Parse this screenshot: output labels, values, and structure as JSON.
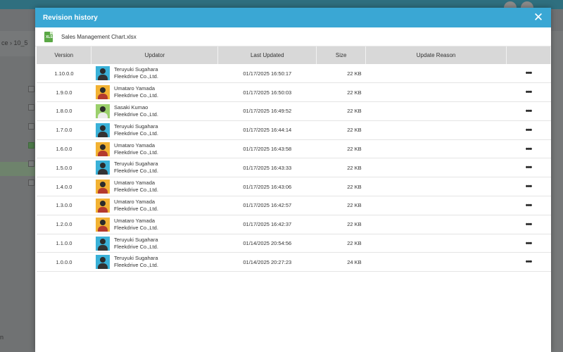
{
  "modal": {
    "title": "Revision history",
    "close_icon": "close-icon",
    "file": {
      "icon": "xlsx-file-icon",
      "icon_text": "XLS",
      "name": "Sales Management Chart.xlsx"
    }
  },
  "background": {
    "breadcrumb": "ce  ›  10_5",
    "footer_text": "n"
  },
  "columns": [
    "Version",
    "Updator",
    "Last Updated",
    "Size",
    "Update Reason",
    ""
  ],
  "rows": [
    {
      "version": "1.10.0.0",
      "name": "Teruyuki Sugahara",
      "company": "Fleekdrive Co.,Ltd.",
      "avatar": "blue",
      "updated": "01/17/2025 16:50:17",
      "size": "22 KB",
      "reason": ""
    },
    {
      "version": "1.9.0.0",
      "name": "Umataro Yamada",
      "company": "Fleekdrive Co.,Ltd.",
      "avatar": "yellow",
      "updated": "01/17/2025 16:50:03",
      "size": "22 KB",
      "reason": ""
    },
    {
      "version": "1.8.0.0",
      "name": "Sasaki Kumao",
      "company": "Fleekdrive Co.,Ltd.",
      "avatar": "green",
      "updated": "01/17/2025 16:49:52",
      "size": "22 KB",
      "reason": ""
    },
    {
      "version": "1.7.0.0",
      "name": "Teruyuki Sugahara",
      "company": "Fleekdrive Co.,Ltd.",
      "avatar": "blue",
      "updated": "01/17/2025 16:44:14",
      "size": "22 KB",
      "reason": ""
    },
    {
      "version": "1.6.0.0",
      "name": "Umataro Yamada",
      "company": "Fleekdrive Co.,Ltd.",
      "avatar": "yellow",
      "updated": "01/17/2025 16:43:58",
      "size": "22 KB",
      "reason": ""
    },
    {
      "version": "1.5.0.0",
      "name": "Teruyuki Sugahara",
      "company": "Fleekdrive Co.,Ltd.",
      "avatar": "blue",
      "updated": "01/17/2025 16:43:33",
      "size": "22 KB",
      "reason": ""
    },
    {
      "version": "1.4.0.0",
      "name": "Umataro Yamada",
      "company": "Fleekdrive Co.,Ltd.",
      "avatar": "yellow",
      "updated": "01/17/2025 16:43:06",
      "size": "22 KB",
      "reason": ""
    },
    {
      "version": "1.3.0.0",
      "name": "Umataro Yamada",
      "company": "Fleekdrive Co.,Ltd.",
      "avatar": "yellow",
      "updated": "01/17/2025 16:42:57",
      "size": "22 KB",
      "reason": ""
    },
    {
      "version": "1.2.0.0",
      "name": "Umataro Yamada",
      "company": "Fleekdrive Co.,Ltd.",
      "avatar": "yellow",
      "updated": "01/17/2025 16:42:37",
      "size": "22 KB",
      "reason": ""
    },
    {
      "version": "1.1.0.0",
      "name": "Teruyuki Sugahara",
      "company": "Fleekdrive Co.,Ltd.",
      "avatar": "blue",
      "updated": "01/14/2025 20:54:56",
      "size": "22 KB",
      "reason": ""
    },
    {
      "version": "1.0.0.0",
      "name": "Teruyuki Sugahara",
      "company": "Fleekdrive Co.,Ltd.",
      "avatar": "blue",
      "updated": "01/14/2025 20:27:23",
      "size": "24 KB",
      "reason": ""
    }
  ],
  "more_label": "•••",
  "colors": {
    "header": "#3aa7d4",
    "table_header": "#d8d8d8",
    "avatar_blue": "#3ab1d8",
    "avatar_yellow": "#f2b233",
    "avatar_green": "#9bd06c"
  }
}
